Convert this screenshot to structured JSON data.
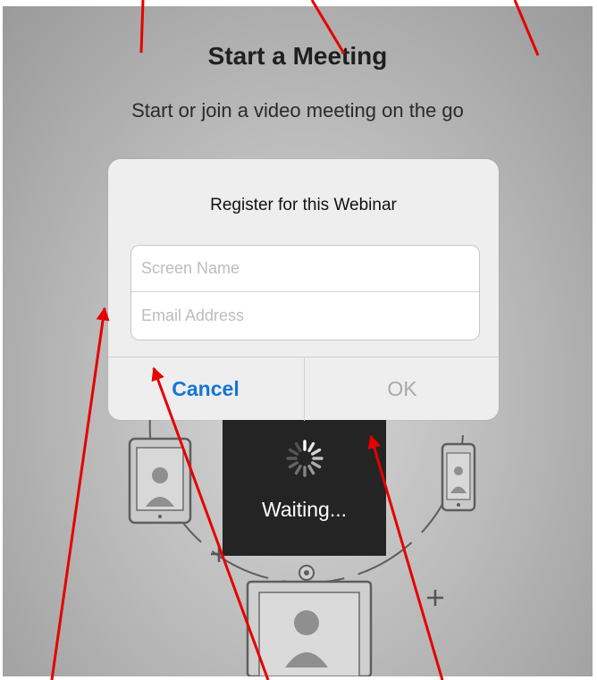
{
  "screen": {
    "title": "Start a Meeting",
    "subtitle": "Start or join a video meeting on the go"
  },
  "dialog": {
    "title": "Register for this Webinar",
    "screen_name_placeholder": "Screen Name",
    "email_placeholder": "Email Address",
    "cancel_label": "Cancel",
    "ok_label": "OK"
  },
  "loading": {
    "label": "Waiting..."
  },
  "colors": {
    "accent": "#1676d3",
    "annotation": "#e60000",
    "overlay": "#242424"
  },
  "icons": [
    "tablet-icon",
    "phone-icon",
    "room-system-icon",
    "spinner-icon"
  ]
}
